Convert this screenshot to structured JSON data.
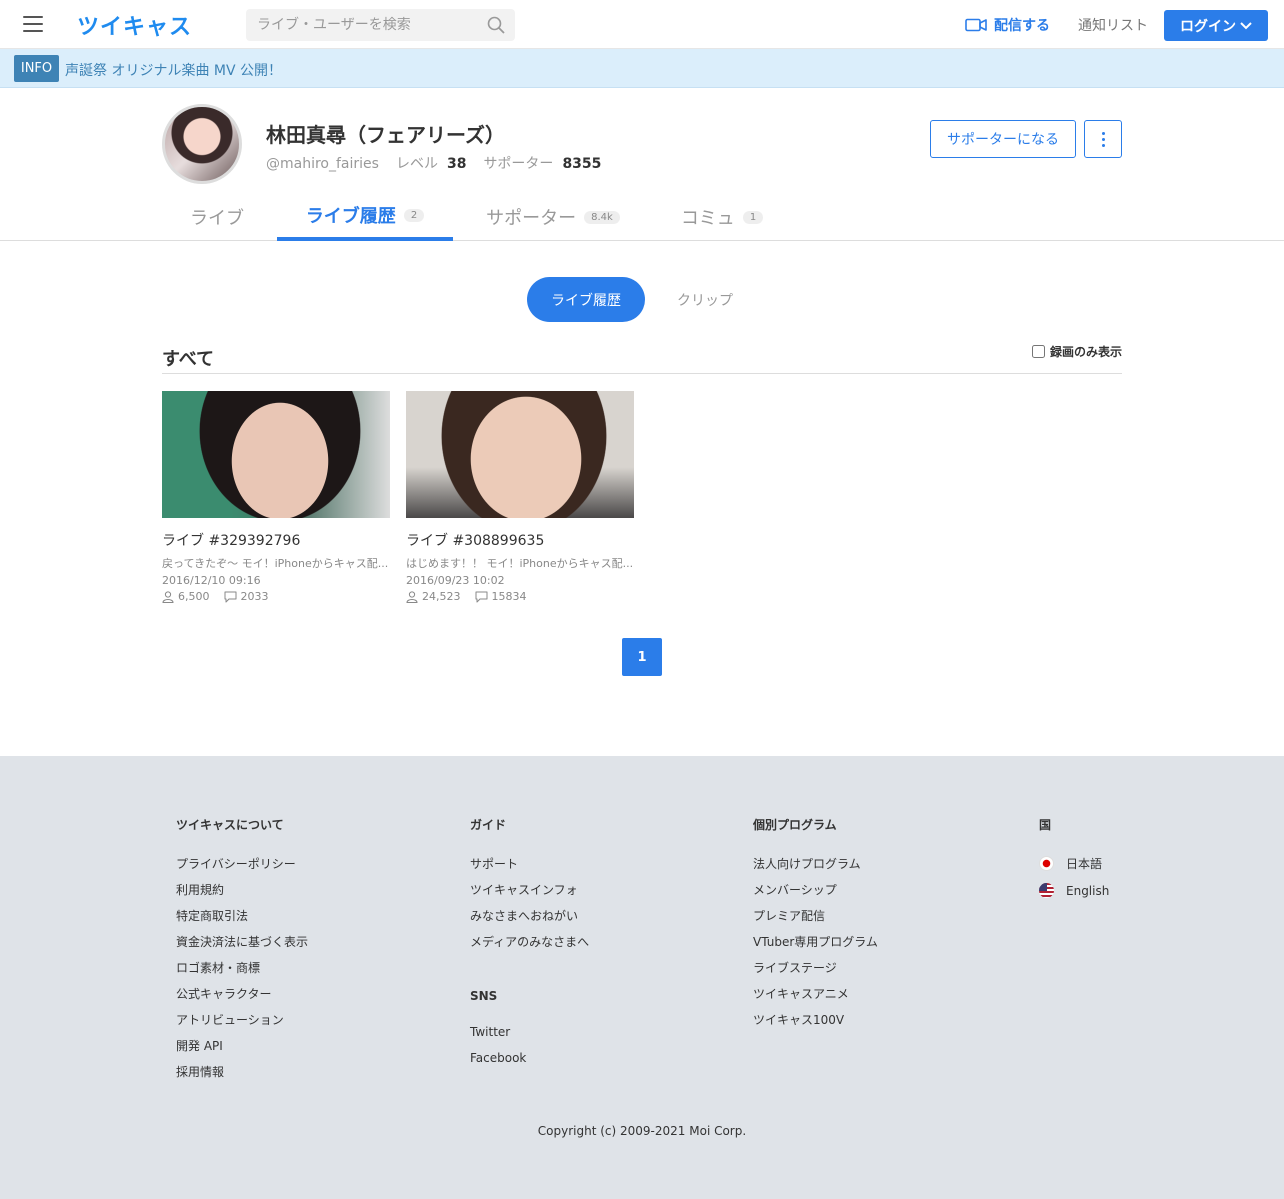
{
  "header": {
    "logo": "ツイキャス",
    "search_placeholder": "ライブ・ユーザーを検索",
    "broadcast_label": "配信する",
    "notif_label": "通知リスト",
    "login_label": "ログイン"
  },
  "info": {
    "badge": "INFO",
    "text": " 声誕祭 オリジナル楽曲 MV 公開！"
  },
  "profile": {
    "name": "林田真尋（フェアリーズ）",
    "handle": "@mahiro_fairies",
    "level_label": "レベル",
    "level_value": "38",
    "supporter_label": "サポーター",
    "supporter_value": "8355",
    "support_button": "サポーターになる"
  },
  "tabs": [
    {
      "label": "ライブ",
      "count": ""
    },
    {
      "label": "ライブ履歴",
      "count": "2"
    },
    {
      "label": "サポーター",
      "count": "8.4k"
    },
    {
      "label": "コミュ",
      "count": "1"
    }
  ],
  "segment": {
    "active": "ライブ履歴",
    "clip": "クリップ"
  },
  "section": {
    "title": "すべて",
    "record_only": "録画のみ表示"
  },
  "cards": [
    {
      "title": "ライブ #329392796",
      "sub": "戻ってきたぞ〜 モイ！iPhoneからキャス配...",
      "date": "2016/12/10 09:16",
      "viewers": "6,500",
      "comments": "2033"
    },
    {
      "title": "ライブ #308899635",
      "sub": "はじめます！！ モイ！iPhoneからキャス配...",
      "date": "2016/09/23 10:02",
      "viewers": "24,523",
      "comments": "15834"
    }
  ],
  "pager": {
    "current": "1"
  },
  "footer": {
    "col1": {
      "head": "ツイキャスについて",
      "links": [
        "プライバシーポリシー",
        "利用規約",
        "特定商取引法",
        "資金決済法に基づく表示",
        "ロゴ素材・商標",
        "公式キャラクター",
        "アトリビューション",
        "開発 API",
        "採用情報"
      ]
    },
    "col2": {
      "head": "ガイド",
      "links": [
        "サポート",
        "ツイキャスインフォ",
        "みなさまへおねがい",
        "メディアのみなさまへ"
      ]
    },
    "col2b": {
      "head": "SNS",
      "links": [
        "Twitter",
        "Facebook"
      ]
    },
    "col3": {
      "head": "個別プログラム",
      "links": [
        "法人向けプログラム",
        "メンバーシップ",
        "プレミア配信",
        "VTuber専用プログラム",
        "ライブステージ",
        "ツイキャスアニメ",
        "ツイキャス100V"
      ]
    },
    "col4": {
      "head": "国",
      "links": [
        "日本語",
        "English"
      ]
    },
    "copyright": "Copyright (c) 2009-2021 Moi Corp."
  },
  "colors": {
    "accent": "#2b7de9",
    "info_bg": "#dbeefb",
    "footer_bg": "#dfe3e8"
  }
}
